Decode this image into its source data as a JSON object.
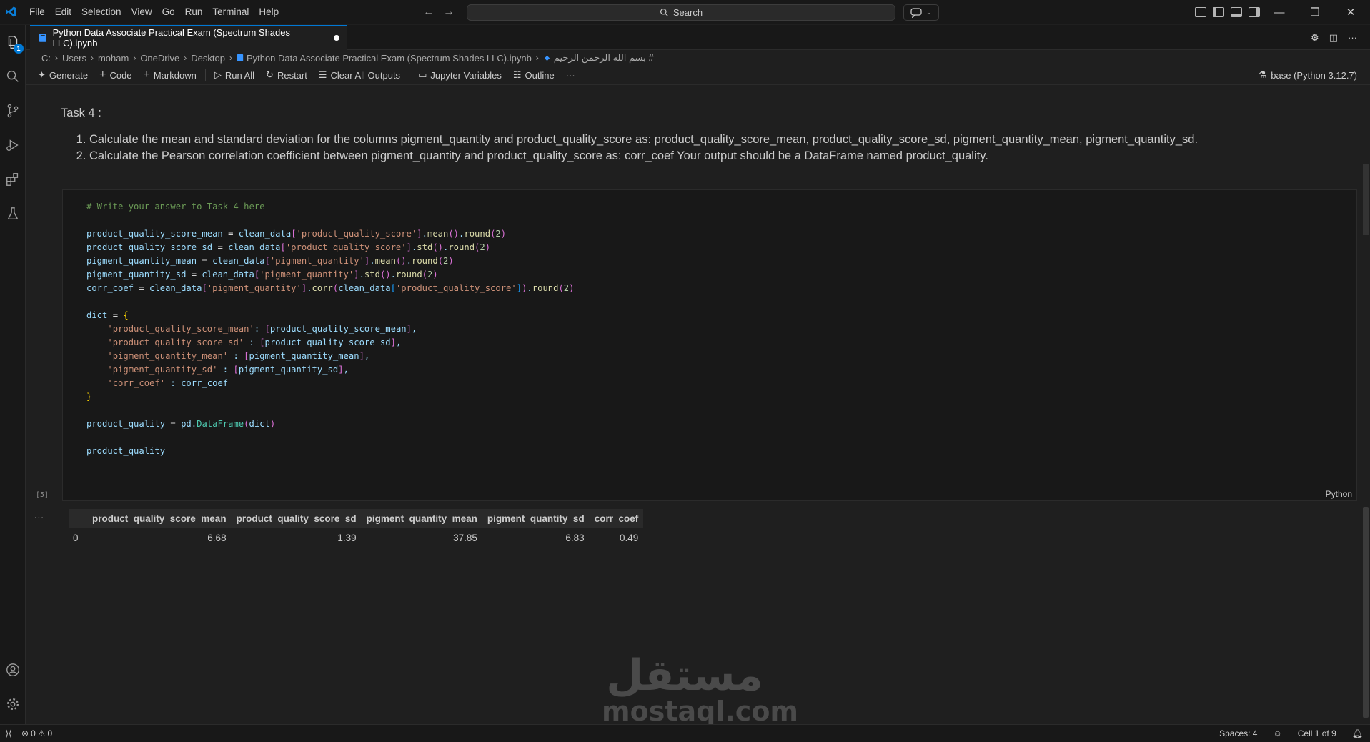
{
  "menu": [
    "File",
    "Edit",
    "Selection",
    "View",
    "Go",
    "Run",
    "Terminal",
    "Help"
  ],
  "search": {
    "label": "Search"
  },
  "tab": {
    "title": "Python Data Associate Practical Exam (Spectrum Shades LLC).ipynb"
  },
  "breadcrumb": {
    "items": [
      "C:",
      "Users",
      "moham",
      "OneDrive",
      "Desktop",
      "Python Data Associate Practical Exam (Spectrum Shades LLC).ipynb",
      "# بسم الله الرحمن الرحيم"
    ]
  },
  "toolbar": {
    "generate": "Generate",
    "code": "Code",
    "markdown": "Markdown",
    "run_all": "Run All",
    "restart": "Restart",
    "clear_outputs": "Clear All Outputs",
    "variables": "Jupyter Variables",
    "outline": "Outline",
    "more": "···",
    "kernel": "base (Python 3.12.7)"
  },
  "activity": {
    "explorer_badge": "1"
  },
  "markdown_cell": {
    "heading": "Task 4 :",
    "items": [
      "Calculate the mean and standard deviation for the columns pigment_quantity and product_quality_score as: product_quality_score_mean, product_quality_score_sd, pigment_quantity_mean, pigment_quantity_sd.",
      "Calculate the Pearson correlation coefficient between pigment_quantity and product_quality_score as: corr_coef Your output should be a DataFrame named product_quality."
    ]
  },
  "code_cell": {
    "language": "Python",
    "exec_count": "[5]"
  },
  "output": {
    "more": "...",
    "columns": [
      "",
      "product_quality_score_mean",
      "product_quality_score_sd",
      "pigment_quantity_mean",
      "pigment_quantity_sd",
      "corr_coef"
    ],
    "rows": [
      [
        "0",
        "6.68",
        "1.39",
        "37.85",
        "6.83",
        "0.49"
      ]
    ]
  },
  "watermark": {
    "top": "مستقل",
    "bottom": "mostaql.com"
  },
  "statusbar": {
    "errors": "0",
    "warnings": "0",
    "spaces": "Spaces: 4",
    "cell": "Cell 1 of 9"
  },
  "colors": {
    "accent": "#0078d4",
    "background": "#1f1f1f",
    "chrome": "#181818"
  }
}
